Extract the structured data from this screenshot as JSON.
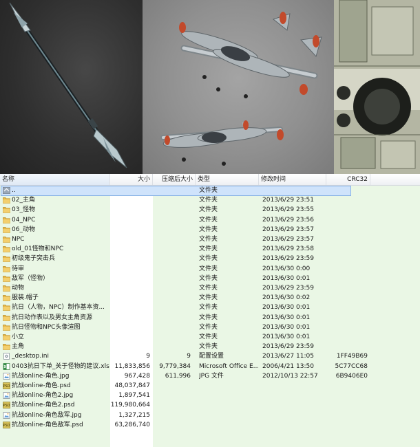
{
  "header": {
    "name": "名称",
    "size": "大小",
    "packed": "压缩后大小",
    "type": "类型",
    "modified": "修改时间",
    "crc": "CRC32"
  },
  "files": [
    {
      "name": "..",
      "size": "",
      "packed": "",
      "type": "文件夹",
      "modified": "",
      "crc": "",
      "icon": "parent-folder-icon",
      "selected": true
    },
    {
      "name": "02_主角",
      "size": "",
      "packed": "",
      "type": "文件夹",
      "modified": "2013/6/29 23:51",
      "crc": "",
      "icon": "folder-icon"
    },
    {
      "name": "03_怪物",
      "size": "",
      "packed": "",
      "type": "文件夹",
      "modified": "2013/6/29 23:55",
      "crc": "",
      "icon": "folder-icon"
    },
    {
      "name": "04_NPC",
      "size": "",
      "packed": "",
      "type": "文件夹",
      "modified": "2013/6/29 23:56",
      "crc": "",
      "icon": "folder-icon"
    },
    {
      "name": "06_动物",
      "size": "",
      "packed": "",
      "type": "文件夹",
      "modified": "2013/6/29 23:57",
      "crc": "",
      "icon": "folder-icon"
    },
    {
      "name": "NPC",
      "size": "",
      "packed": "",
      "type": "文件夹",
      "modified": "2013/6/29 23:57",
      "crc": "",
      "icon": "folder-icon"
    },
    {
      "name": "old_01怪物和NPC",
      "size": "",
      "packed": "",
      "type": "文件夹",
      "modified": "2013/6/29 23:58",
      "crc": "",
      "icon": "folder-icon"
    },
    {
      "name": "初级鬼子突击兵",
      "size": "",
      "packed": "",
      "type": "文件夹",
      "modified": "2013/6/29 23:59",
      "crc": "",
      "icon": "folder-icon"
    },
    {
      "name": "待审",
      "size": "",
      "packed": "",
      "type": "文件夹",
      "modified": "2013/6/30 0:00",
      "crc": "",
      "icon": "folder-icon"
    },
    {
      "name": "敌军（怪物）",
      "size": "",
      "packed": "",
      "type": "文件夹",
      "modified": "2013/6/30 0:01",
      "crc": "",
      "icon": "folder-icon"
    },
    {
      "name": "动物",
      "size": "",
      "packed": "",
      "type": "文件夹",
      "modified": "2013/6/29 23:59",
      "crc": "",
      "icon": "folder-icon"
    },
    {
      "name": "服装.帽子",
      "size": "",
      "packed": "",
      "type": "文件夹",
      "modified": "2013/6/30 0:02",
      "crc": "",
      "icon": "folder-icon"
    },
    {
      "name": "抗日（人物，NPC）制作基本资...",
      "size": "",
      "packed": "",
      "type": "文件夹",
      "modified": "2013/6/30 0:01",
      "crc": "",
      "icon": "folder-icon"
    },
    {
      "name": "抗日动作表以及男女主角资源",
      "size": "",
      "packed": "",
      "type": "文件夹",
      "modified": "2013/6/30 0:01",
      "crc": "",
      "icon": "folder-icon"
    },
    {
      "name": "抗日怪物和NPC头像渲图",
      "size": "",
      "packed": "",
      "type": "文件夹",
      "modified": "2013/6/30 0:01",
      "crc": "",
      "icon": "folder-icon"
    },
    {
      "name": "小立",
      "size": "",
      "packed": "",
      "type": "文件夹",
      "modified": "2013/6/30 0:01",
      "crc": "",
      "icon": "folder-icon"
    },
    {
      "name": "主角",
      "size": "",
      "packed": "",
      "type": "文件夹",
      "modified": "2013/6/29 23:59",
      "crc": "",
      "icon": "folder-icon"
    },
    {
      "name": "_desktop.ini",
      "size": "9",
      "packed": "9",
      "type": "配置设置",
      "modified": "2013/6/27 11:05",
      "crc": "1FF49B69",
      "icon": "settings-file-icon"
    },
    {
      "name": "0403抗日下单_关于怪物的建议.xls",
      "size": "11,833,856",
      "packed": "9,779,384",
      "type": "Microsoft Office E...",
      "modified": "2006/4/21 13:50",
      "crc": "5C77CC68",
      "icon": "excel-file-icon"
    },
    {
      "name": "抗战online-角色.jpg",
      "size": "967,428",
      "packed": "611,996",
      "type": "JPG 文件",
      "modified": "2012/10/13 22:57",
      "crc": "6B9406E0",
      "icon": "image-file-icon"
    },
    {
      "name": "抗战online-角色.psd",
      "size": "48,037,847",
      "packed": "",
      "type": "",
      "modified": "",
      "crc": "",
      "icon": "psd-file-icon"
    },
    {
      "name": "抗战online-角色2.jpg",
      "size": "1,897,541",
      "packed": "",
      "type": "",
      "modified": "",
      "crc": "",
      "icon": "image-file-icon"
    },
    {
      "name": "抗战online-角色2.psd",
      "size": "119,980,664",
      "packed": "",
      "type": "",
      "modified": "",
      "crc": "",
      "icon": "psd-file-icon"
    },
    {
      "name": "抗战online-角色敌军.jpg",
      "size": "1,327,215",
      "packed": "",
      "type": "",
      "modified": "",
      "crc": "",
      "icon": "image-file-icon"
    },
    {
      "name": "抗战online-角色敌军.psd",
      "size": "63,286,740",
      "packed": "",
      "type": "",
      "modified": "",
      "crc": "",
      "icon": "psd-file-icon"
    }
  ],
  "colors": {
    "green_column": "#eaf7e5",
    "selection": "#cfe3fb",
    "folder": "#e7b94a",
    "psd_badge": "#d8c35a"
  }
}
